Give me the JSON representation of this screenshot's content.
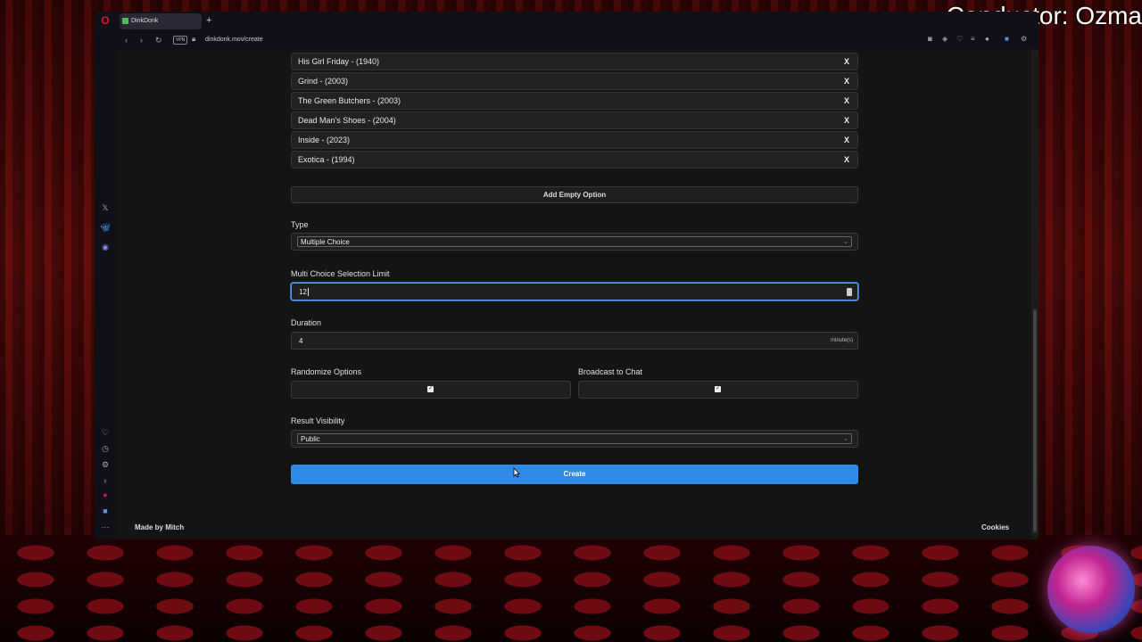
{
  "overlay": {
    "title": "Conductor: Ozma"
  },
  "browser": {
    "tab_title": "DinkDonk",
    "new_tab": "+",
    "vpn_badge": "VPN",
    "url": "dinkdonk.mov/create"
  },
  "form": {
    "options": [
      {
        "label": "His Girl Friday - (1940)",
        "remove": "X"
      },
      {
        "label": "Grind - (2003)",
        "remove": "X"
      },
      {
        "label": "The Green Butchers - (2003)",
        "remove": "X"
      },
      {
        "label": "Dead Man's Shoes - (2004)",
        "remove": "X"
      },
      {
        "label": "Inside - (2023)",
        "remove": "X"
      },
      {
        "label": "Exotica - (1994)",
        "remove": "X"
      }
    ],
    "add_empty_option": "Add Empty Option",
    "type_label": "Type",
    "type_value": "Multiple Choice",
    "limit_label": "Multi Choice Selection Limit",
    "limit_value": "12",
    "duration_label": "Duration",
    "duration_value": "4",
    "duration_unit": "minute(s)",
    "randomize_label": "Randomize Options",
    "randomize_checked": true,
    "broadcast_label": "Broadcast to Chat",
    "broadcast_checked": true,
    "visibility_label": "Result Visibility",
    "visibility_value": "Public",
    "create_button": "Create"
  },
  "footer": {
    "made_by": "Made by Mitch",
    "cookies": "Cookies"
  },
  "colors": {
    "accent": "#2e8be6",
    "focus": "#6b9fe8",
    "background": "#141414"
  }
}
